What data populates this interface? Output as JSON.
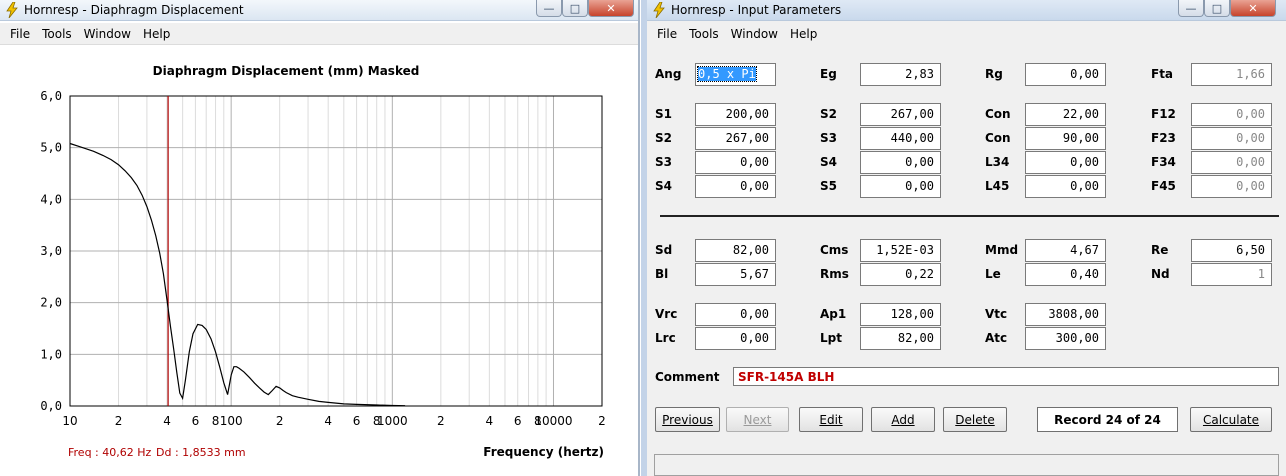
{
  "left_window": {
    "title": "Hornresp - Diaphragm Displacement",
    "menu": [
      "File",
      "Tools",
      "Window",
      "Help"
    ],
    "readout": {
      "freq": "Freq : 40,62 Hz",
      "dd": "Dd : 1,8533 mm"
    }
  },
  "right_window": {
    "title": "Hornresp - Input Parameters",
    "menu": [
      "File",
      "Tools",
      "Window",
      "Help"
    ],
    "rows": [
      [
        {
          "label": "Ang",
          "value": "0,5 x Pi"
        },
        {
          "label": "Eg",
          "value": "2,83"
        },
        {
          "label": "Rg",
          "value": "0,00"
        },
        {
          "label": "Fta",
          "value": "1,66"
        }
      ],
      [
        {
          "label": "S1",
          "value": "200,00"
        },
        {
          "label": "S2",
          "value": "267,00"
        },
        {
          "label": "Con",
          "value": "22,00"
        },
        {
          "label": "F12",
          "value": "0,00"
        }
      ],
      [
        {
          "label": "S2",
          "value": "267,00"
        },
        {
          "label": "S3",
          "value": "440,00"
        },
        {
          "label": "Con",
          "value": "90,00"
        },
        {
          "label": "F23",
          "value": "0,00"
        }
      ],
      [
        {
          "label": "S3",
          "value": "0,00"
        },
        {
          "label": "S4",
          "value": "0,00"
        },
        {
          "label": "L34",
          "value": "0,00"
        },
        {
          "label": "F34",
          "value": "0,00"
        }
      ],
      [
        {
          "label": "S4",
          "value": "0,00"
        },
        {
          "label": "S5",
          "value": "0,00"
        },
        {
          "label": "L45",
          "value": "0,00"
        },
        {
          "label": "F45",
          "value": "0,00"
        }
      ],
      [
        {
          "label": "Sd",
          "value": "82,00"
        },
        {
          "label": "Cms",
          "value": "1,52E-03"
        },
        {
          "label": "Mmd",
          "value": "4,67"
        },
        {
          "label": "Re",
          "value": "6,50"
        }
      ],
      [
        {
          "label": "Bl",
          "value": "5,67"
        },
        {
          "label": "Rms",
          "value": "0,22"
        },
        {
          "label": "Le",
          "value": "0,40"
        },
        {
          "label": "Nd",
          "value": "1"
        }
      ],
      [
        {
          "label": "Vrc",
          "value": "0,00"
        },
        {
          "label": "Ap1",
          "value": "128,00"
        },
        {
          "label": "Vtc",
          "value": "3808,00"
        }
      ],
      [
        {
          "label": "Lrc",
          "value": "0,00"
        },
        {
          "label": "Lpt",
          "value": "82,00"
        },
        {
          "label": "Atc",
          "value": "300,00"
        }
      ]
    ],
    "comment_label": "Comment",
    "comment_value": "SFR-145A BLH",
    "buttons": {
      "previous": "Previous",
      "next": "Next",
      "edit": "Edit",
      "add": "Add",
      "delete": "Delete",
      "calculate": "Calculate"
    },
    "record": "Record 24 of 24"
  },
  "chart_data": {
    "type": "line",
    "title": "Diaphragm Displacement (mm)   Masked",
    "xlabel": "Frequency (hertz)",
    "ylabel": "",
    "x_scale": "log",
    "xlim": [
      10,
      20000
    ],
    "ylim": [
      0,
      6
    ],
    "x_tick_labels": [
      "10",
      "2",
      "4",
      "6",
      "8",
      "100",
      "2",
      "4",
      "6",
      "8",
      "1000",
      "2",
      "4",
      "6",
      "8",
      "10000",
      "2"
    ],
    "y_tick_labels": [
      "0,0",
      "1,0",
      "2,0",
      "3,0",
      "4,0",
      "5,0",
      "6,0"
    ],
    "grid": true,
    "marker_frequency": 40.62,
    "series": [
      {
        "x": [
          10,
          12,
          14,
          16,
          18,
          20,
          22,
          24,
          26,
          28,
          30,
          32,
          34,
          36,
          38,
          40,
          42,
          44,
          46,
          48,
          50,
          52,
          55,
          58,
          62,
          66,
          70,
          75,
          80,
          85,
          90,
          95,
          100,
          104,
          108,
          112,
          120,
          130,
          140,
          150,
          160,
          170,
          180,
          190,
          200,
          210,
          220,
          240,
          260,
          300,
          350,
          400,
          500,
          600,
          800,
          1000,
          1200
        ],
        "y": [
          5.08,
          5.0,
          4.93,
          4.85,
          4.77,
          4.67,
          4.55,
          4.42,
          4.27,
          4.08,
          3.86,
          3.6,
          3.3,
          2.96,
          2.56,
          2.05,
          1.55,
          1.1,
          0.65,
          0.25,
          0.15,
          0.5,
          1.05,
          1.4,
          1.58,
          1.56,
          1.48,
          1.3,
          1.05,
          0.75,
          0.45,
          0.22,
          0.6,
          0.76,
          0.76,
          0.73,
          0.66,
          0.55,
          0.44,
          0.35,
          0.27,
          0.22,
          0.3,
          0.38,
          0.35,
          0.3,
          0.26,
          0.2,
          0.17,
          0.13,
          0.09,
          0.07,
          0.04,
          0.03,
          0.02,
          0.01,
          0.005
        ]
      }
    ]
  }
}
